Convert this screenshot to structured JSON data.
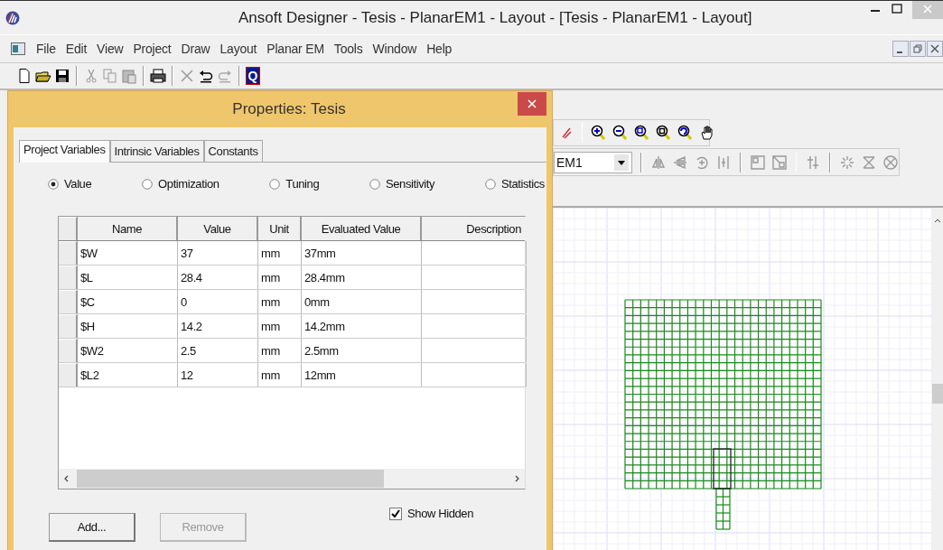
{
  "window": {
    "title": "Ansoft Designer  - Tesis - PlanarEM1 - Layout - [Tesis - PlanarEM1 - Layout]"
  },
  "menu": [
    "File",
    "Edit",
    "View",
    "Project",
    "Draw",
    "Layout",
    "Planar EM",
    "Tools",
    "Window",
    "Help"
  ],
  "toolbar": {
    "badge_letter": "Q"
  },
  "design_selector": {
    "value": "EM1"
  },
  "dialog": {
    "title": "Properties: Tesis",
    "tabs": [
      {
        "label": "Project Variables",
        "selected": true
      },
      {
        "label": "Intrinsic Variables",
        "selected": false
      },
      {
        "label": "Constants",
        "selected": false
      }
    ],
    "modes": [
      {
        "label": "Value",
        "selected": true
      },
      {
        "label": "Optimization",
        "selected": false
      },
      {
        "label": "Tuning",
        "selected": false
      },
      {
        "label": "Sensitivity",
        "selected": false
      },
      {
        "label": "Statistics",
        "selected": false
      }
    ],
    "table": {
      "columns": [
        "Name",
        "Value",
        "Unit",
        "Evaluated Value",
        "Description"
      ],
      "rows": [
        [
          "$W",
          "37",
          "mm",
          "37mm",
          ""
        ],
        [
          "$L",
          "28.4",
          "mm",
          "28.4mm",
          ""
        ],
        [
          "$C",
          "0",
          "mm",
          "0mm",
          ""
        ],
        [
          "$H",
          "14.2",
          "mm",
          "14.2mm",
          ""
        ],
        [
          "$W2",
          "2.5",
          "mm",
          "2.5mm",
          ""
        ],
        [
          "$L2",
          "12",
          "mm",
          "12mm",
          ""
        ]
      ]
    },
    "show_hidden": {
      "label": "Show Hidden",
      "checked": true
    },
    "buttons": [
      {
        "label": "Add...",
        "disabled": false
      },
      {
        "label": "Remove",
        "disabled": true
      }
    ]
  }
}
